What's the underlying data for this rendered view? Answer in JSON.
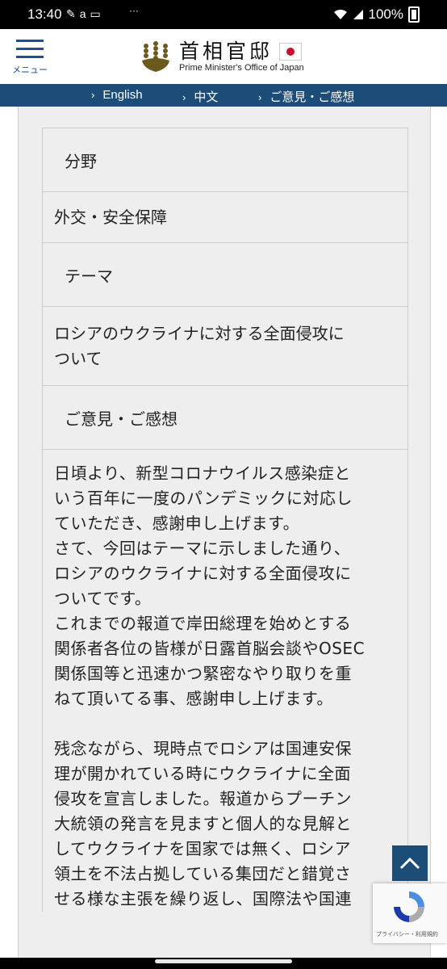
{
  "status_bar": {
    "time": "13:40",
    "left_icons": [
      "game-icon",
      "amazon-icon",
      "tv-icon"
    ],
    "more_indicator": "···",
    "battery": "100%",
    "right_icons": [
      "wifi-icon",
      "signal-icon",
      "battery-icon"
    ]
  },
  "header": {
    "menu_label": "メニュー",
    "logo_title": "首相官邸",
    "logo_subtitle": "Prime Minister's Office of Japan"
  },
  "language_nav": [
    {
      "label": "English"
    },
    {
      "label": "中文"
    },
    {
      "label": "ご意見・ご感想"
    }
  ],
  "form": {
    "field_label": "分野",
    "field_value": "外交・安全保障",
    "theme_label": "テーマ",
    "theme_value_lines": [
      "ロシアのウクライナに対する全面侵攻に",
      "ついて"
    ],
    "comment_label": "ご意見・ご感想",
    "comment_lines": [
      "日頃より、新型コロナウイルス感染症と",
      "いう百年に一度のパンデミックに対応し",
      "ていただき、感謝申し上げます。",
      "さて、今回はテーマに示しました通り、",
      "ロシアのウクライナに対する全面侵攻に",
      "ついてです。",
      "これまでの報道で岸田総理を始めとする",
      "関係者各位の皆様が日露首脳会談やOSEC",
      "関係国等と迅速かつ緊密なやり取りを重",
      "ねて頂いてる事、感謝申し上げます。",
      "",
      "残念ながら、現時点でロシアは国連安保",
      "理が開かれている時にウクライナに全面",
      "侵攻を宣言しました。報道からプーチン",
      "大統領の発言を見ますと個人的な見解と",
      "してウクライナを国家では無く、ロシア",
      "領土を不法占拠している集団だと錯覚さ",
      "せる様な主張を繰り返し、国際法や国連"
    ]
  },
  "recaptcha": {
    "text": "プライバシー・利用規約"
  },
  "colors": {
    "nav_bg": "#1c4c78",
    "brand_blue": "#1d4f91",
    "panel_bg": "#eeeeee"
  }
}
